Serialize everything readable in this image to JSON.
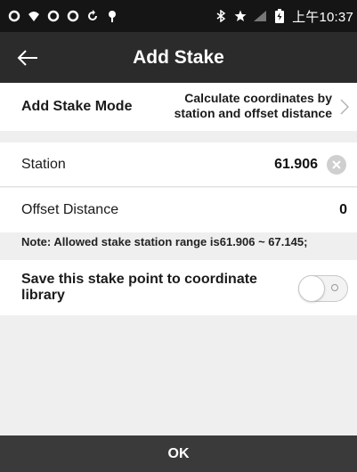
{
  "status_bar": {
    "time": "上午10:37",
    "icons": [
      "sync-icon",
      "wifi-icon",
      "sync-icon",
      "sync-icon",
      "refresh-icon",
      "antenna-icon",
      "bluetooth-icon",
      "star-icon",
      "no-signal-icon",
      "battery-icon"
    ]
  },
  "app_bar": {
    "title": "Add Stake",
    "back_icon": "arrow-left-icon"
  },
  "form": {
    "mode_label": "Add Stake Mode",
    "mode_value_line1": "Calculate coordinates by",
    "mode_value_line2": "station and offset distance",
    "station_label": "Station",
    "station_value": "61.906",
    "offset_label": "Offset Distance",
    "offset_value": "0",
    "note": "Note: Allowed stake station range is61.906 ~ 67.145;",
    "save_label": "Save this stake point to coordinate library",
    "save_toggle_on": false
  },
  "footer": {
    "ok_label": "OK"
  },
  "colors": {
    "status_bar": "#151515",
    "app_bar": "#2b2b2b",
    "footer": "#3a3a3a",
    "background": "#efefef"
  }
}
